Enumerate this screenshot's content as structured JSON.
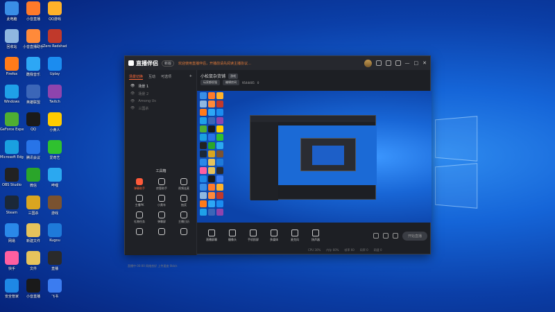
{
  "desktop": {
    "icons": [
      {
        "label": "此电脑",
        "color": "#3a8ee6",
        "icon": "computer-icon"
      },
      {
        "label": "小音直播",
        "color": "#ff7a2a",
        "icon": "app-icon"
      },
      {
        "label": "QQ游戏",
        "color": "#ffb22a",
        "icon": "game-icon"
      },
      {
        "label": "回收站",
        "color": "#8fb7e0",
        "icon": "recycle-bin-icon"
      },
      {
        "label": "小音直播助手",
        "color": "#ff8a3a",
        "icon": "app-icon"
      },
      {
        "label": "Zero Redshadow",
        "color": "#c0392b",
        "icon": "game-icon"
      },
      {
        "label": "Firefox",
        "color": "#ff7b1a",
        "icon": "firefox-icon"
      },
      {
        "label": "酷我音乐",
        "color": "#2da7f5",
        "icon": "music-icon"
      },
      {
        "label": "Uplay",
        "color": "#1b8cf0",
        "icon": "uplay-icon"
      },
      {
        "label": "Windows",
        "color": "#1fa0e8",
        "icon": "windows-icon"
      },
      {
        "label": "英雄联盟",
        "color": "#3b66b8",
        "icon": "game-icon"
      },
      {
        "label": "Twitch",
        "color": "#8e44ad",
        "icon": "twitch-icon"
      },
      {
        "label": "GeForce Experience",
        "color": "#4fae32",
        "icon": "nvidia-icon"
      },
      {
        "label": "QQ",
        "color": "#1a1a1a",
        "icon": "qq-icon"
      },
      {
        "label": "小黄人",
        "color": "#ffcc00",
        "icon": "game-icon"
      },
      {
        "label": "Microsoft Edge",
        "color": "#1aa0e0",
        "icon": "edge-icon"
      },
      {
        "label": "腾讯会议",
        "color": "#2874e8",
        "icon": "app-icon"
      },
      {
        "label": "爱奇艺",
        "color": "#2fc12f",
        "icon": "iqiyi-icon"
      },
      {
        "label": "OBS Studio",
        "color": "#222222",
        "icon": "obs-icon"
      },
      {
        "label": "微信",
        "color": "#2aa52a",
        "icon": "wechat-icon"
      },
      {
        "label": "哔哩",
        "color": "#2ba8f0",
        "icon": "app-icon"
      },
      {
        "label": "Steam",
        "color": "#1b2838",
        "icon": "steam-icon"
      },
      {
        "label": "三国杀",
        "color": "#d9a520",
        "icon": "game-icon"
      },
      {
        "label": "游戏",
        "color": "#7a5230",
        "icon": "game-icon"
      },
      {
        "label": "网易",
        "color": "#2a88e8",
        "icon": "app-icon"
      },
      {
        "label": "新建文件",
        "color": "#e6c35c",
        "icon": "folder-icon"
      },
      {
        "label": "Kugou",
        "color": "#1e7ad9",
        "icon": "kugou-icon"
      },
      {
        "label": "快手",
        "color": "#ff5fa0",
        "icon": "app-icon"
      },
      {
        "label": "文件",
        "color": "#e6c35c",
        "icon": "folder-icon"
      },
      {
        "label": "直播",
        "color": "#2a2a2a",
        "icon": "app-icon"
      },
      {
        "label": "安全管家",
        "color": "#1e88e5",
        "icon": "shield-icon"
      },
      {
        "label": "小音直播",
        "color": "#1a1a1a",
        "icon": "app-icon"
      },
      {
        "label": "飞书",
        "color": "#3b7cf0",
        "icon": "app-icon"
      }
    ]
  },
  "app": {
    "logo": "直播伴侣",
    "version": "新版",
    "notice": "欢迎使用直播伴侣，开播前请先阅读主播协议…",
    "left_tabs": [
      "场景切换",
      "互动",
      "可选项"
    ],
    "scenes": [
      {
        "name": "场景 1",
        "dim": false
      },
      {
        "name": "场景 2",
        "dim": true
      },
      {
        "name": "Among Us",
        "dim": true
      },
      {
        "name": "三国杀",
        "dim": true
      }
    ],
    "tools_title": "工具箱",
    "tools": [
      {
        "label": "弹幕助手",
        "red": true,
        "icon": "barrage-icon"
      },
      {
        "label": "房管助手",
        "red": false,
        "icon": "admin-icon"
      },
      {
        "label": "视频连麦",
        "red": false,
        "icon": "video-icon"
      },
      {
        "label": "主播PK",
        "red": false,
        "icon": "pk-icon"
      },
      {
        "label": "小黄车",
        "red": false,
        "icon": "cart-icon"
      },
      {
        "label": "抽奖",
        "red": false,
        "icon": "gift-icon"
      },
      {
        "label": "礼物任务",
        "red": false,
        "icon": "task-icon"
      },
      {
        "label": "弹幕屏",
        "red": false,
        "icon": "screen-icon"
      },
      {
        "label": "主播日历",
        "red": false,
        "icon": "calendar-icon"
      },
      {
        "label": "",
        "red": false,
        "icon": "upload-icon"
      },
      {
        "label": "",
        "red": false,
        "icon": "share-icon"
      },
      {
        "label": "",
        "red": false,
        "icon": "cloud-icon"
      }
    ],
    "footer_left": "直播中 00:00  网络良好  上传速度 0kb/s",
    "room_title": "小松鼠杂货铺",
    "room_tag": "游戏",
    "room_id_label": "9544405",
    "room_fans": "0",
    "room_pills": [
      "玩家都很强",
      "编辑房间"
    ],
    "bottom_buttons": [
      {
        "label": "直播屏幕",
        "icon": "screen-icon"
      },
      {
        "label": "摄像头",
        "icon": "camera-icon"
      },
      {
        "label": "手机投屏",
        "icon": "phone-icon"
      },
      {
        "label": "多媒体",
        "icon": "media-icon"
      },
      {
        "label": "麦克风",
        "icon": "mic-icon"
      },
      {
        "label": "扬声器",
        "icon": "speaker-icon"
      }
    ],
    "start_live": "开始直播",
    "status": [
      "CPU 30%",
      "内存 60%",
      "帧率 60",
      "码率 0",
      "网速 0"
    ]
  }
}
